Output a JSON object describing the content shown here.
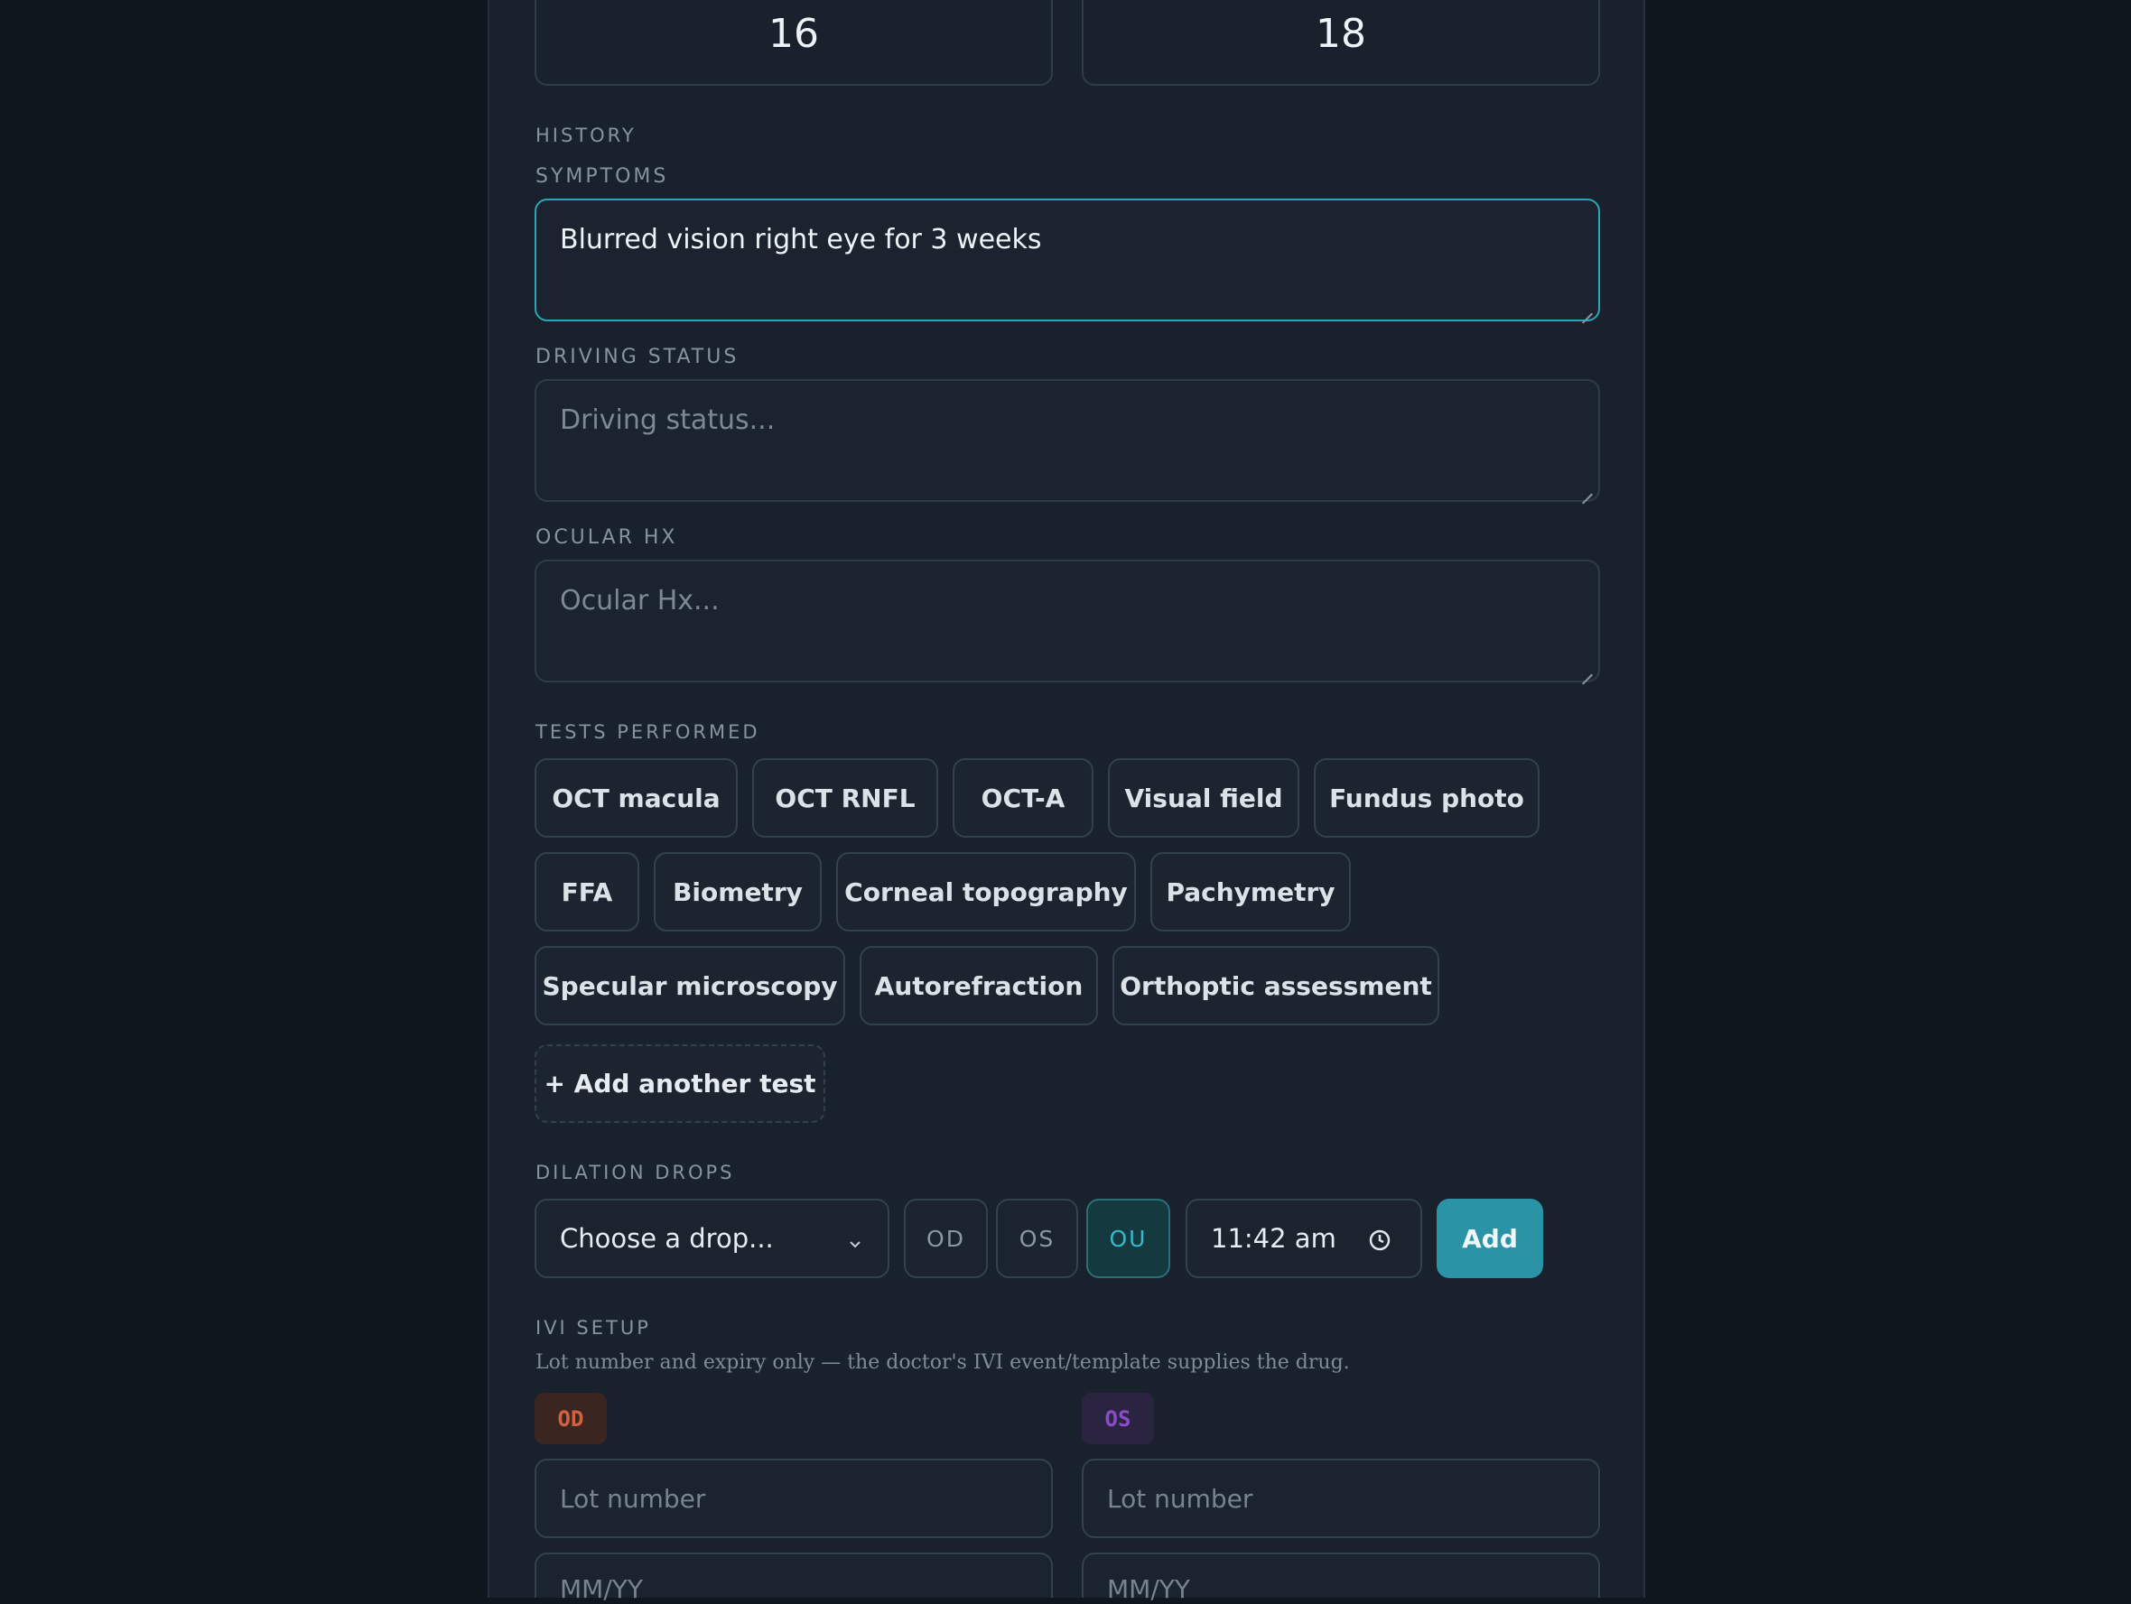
{
  "iop": {
    "od_value": "16",
    "os_value": "18"
  },
  "history": {
    "section_label": "HISTORY",
    "symptoms": {
      "label": "SYMPTOMS",
      "value": "Blurred vision right eye for 3 weeks"
    },
    "driving_status": {
      "label": "DRIVING STATUS",
      "placeholder": "Driving status..."
    },
    "ocular_hx": {
      "label": "OCULAR HX",
      "placeholder": "Ocular Hx..."
    }
  },
  "tests": {
    "label": "TESTS PERFORMED",
    "items": [
      "OCT macula",
      "OCT RNFL",
      "OCT-A",
      "Visual field",
      "Fundus photo",
      "FFA",
      "Biometry",
      "Corneal topography",
      "Pachymetry",
      "Specular microscopy",
      "Autorefraction",
      "Orthoptic assessment"
    ],
    "add_label": "+ Add another test"
  },
  "dilation": {
    "label": "DILATION DROPS",
    "select_value": "Choose a drop...",
    "eyes": [
      "OD",
      "OS",
      "OU"
    ],
    "selected_eye": "OU",
    "time": "11:42 am",
    "add_label": "Add"
  },
  "ivi": {
    "label": "IVI SETUP",
    "hint": "Lot number and expiry only — the doctor's IVI event/template supplies the drug.",
    "od_badge": "OD",
    "os_badge": "OS",
    "lot_placeholder": "Lot number",
    "expiry_placeholder": "MM/YY"
  },
  "colors": {
    "accent": "#2a93a6",
    "od": "#d0623f",
    "os": "#8a4bc8",
    "panel": "#19222c",
    "background": "#0f161d"
  }
}
